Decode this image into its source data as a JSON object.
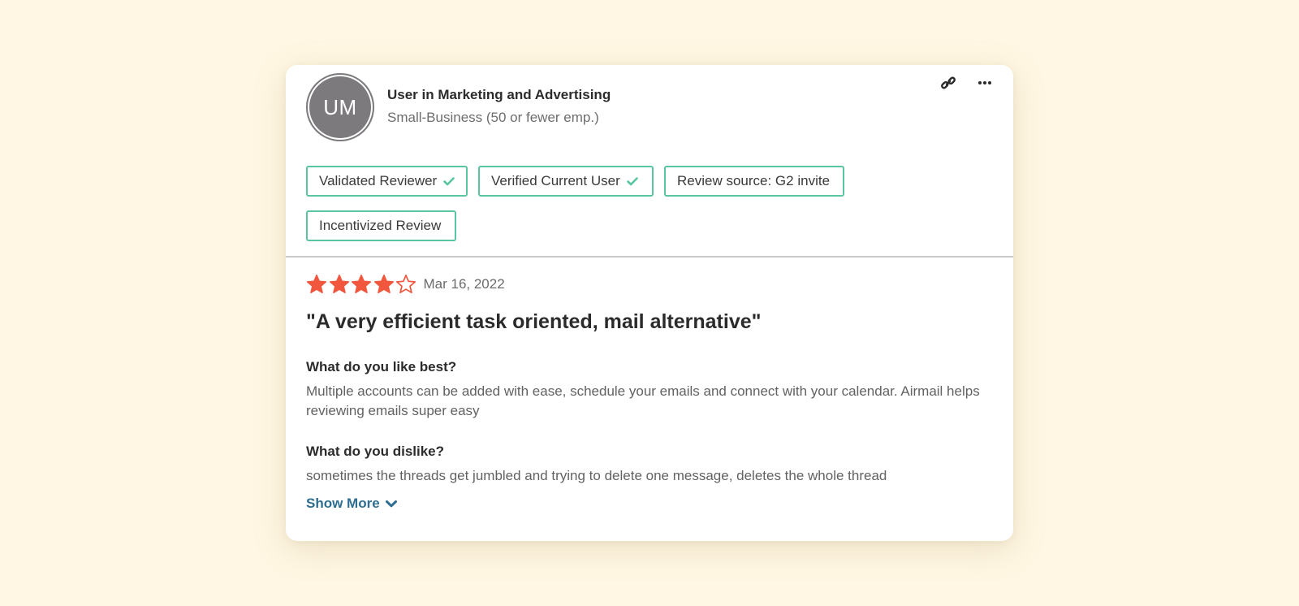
{
  "reviewer": {
    "initials": "UM",
    "name": "User in Marketing and Advertising",
    "segment": "Small-Business (50 or fewer emp.)"
  },
  "actions": {
    "link_icon": "link-icon",
    "more_icon": "more-horizontal-icon"
  },
  "badges": [
    {
      "label": "Validated Reviewer",
      "checked": true
    },
    {
      "label": "Verified Current User",
      "checked": true
    },
    {
      "label": "Review source: G2 invite",
      "checked": false
    },
    {
      "label": "Incentivized Review",
      "checked": false
    }
  ],
  "review": {
    "rating": 4,
    "max_rating": 5,
    "date": "Mar 16, 2022",
    "title": "\"A very efficient task oriented, mail alternative\"",
    "questions": [
      {
        "question": "What do you like best?",
        "answer": "Multiple accounts can be added with ease, schedule your emails and connect with your calendar. Airmail helps reviewing emails super easy"
      },
      {
        "question": "What do you dislike?",
        "answer": "sometimes the threads get jumbled and trying to delete one message, deletes the whole thread"
      }
    ],
    "show_more_label": "Show More"
  },
  "colors": {
    "background": "#fff7e3",
    "badge_border": "#5ac4a3",
    "star": "#f0573d",
    "link": "#2e6e90",
    "avatar": "#7d7a7e"
  }
}
